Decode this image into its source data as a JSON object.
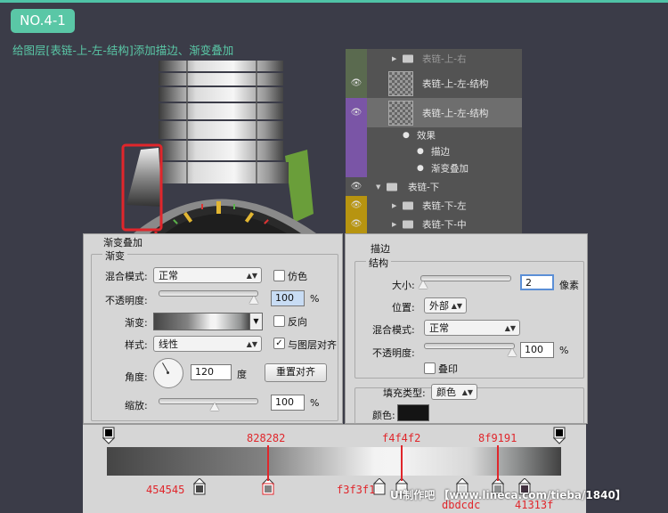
{
  "header": {
    "badge": "NO.4-1",
    "subtitle": "给图层[表链-上-左-结构]添加描边、渐变叠加"
  },
  "colors": {
    "accent": "#5ac7a6",
    "annotation": "#e0262b",
    "strap": "#6a9e3a"
  },
  "layers": [
    {
      "label": "表链-上-右",
      "kind": "folder",
      "color": "#5a6a4f",
      "eye": false
    },
    {
      "label": "表链-上-左-结构",
      "kind": "layer",
      "color": "#5a6a4f",
      "eye": true
    },
    {
      "label": "表链-上-左-结构",
      "kind": "layer",
      "color": "#7a55a6",
      "eye": true,
      "selected": true
    },
    {
      "label": "效果",
      "kind": "fx",
      "color": "#7a55a6",
      "eye": true
    },
    {
      "label": "描边",
      "kind": "fx-item",
      "color": "#7a55a6",
      "eye": true
    },
    {
      "label": "渐变叠加",
      "kind": "fx-item",
      "color": "#7a55a6",
      "eye": true
    },
    {
      "label": "表链-下",
      "kind": "group",
      "color": "#535353",
      "eye": true
    },
    {
      "label": "表链-下-左",
      "kind": "folder",
      "color": "#b79410",
      "eye": true
    },
    {
      "label": "表链-下-中",
      "kind": "folder",
      "color": "#b79410",
      "eye": true
    }
  ],
  "gradient_overlay": {
    "title": "渐变叠加",
    "group": "渐变",
    "blend_mode_label": "混合模式:",
    "blend_mode": "正常",
    "dither_label": "仿色",
    "opacity_label": "不透明度:",
    "opacity": "100",
    "percent": "%",
    "gradient_label": "渐变:",
    "reverse_label": "反向",
    "style_label": "样式:",
    "style": "线性",
    "align_label": "与图层对齐",
    "angle_label": "角度:",
    "angle": "120",
    "degree": "度",
    "reset_label": "重置对齐",
    "scale_label": "缩放:",
    "scale": "100"
  },
  "stroke": {
    "title": "描边",
    "group": "结构",
    "size_label": "大小:",
    "size": "2",
    "unit": "像素",
    "position_label": "位置:",
    "position": "外部",
    "blend_label": "混合模式:",
    "blend": "正常",
    "opacity_label": "不透明度:",
    "opacity": "100",
    "percent": "%",
    "overprint_label": "叠印",
    "fill_type_label": "填充类型:",
    "fill_type": "颜色",
    "color_label": "颜色:",
    "color": "#141414"
  },
  "gradient_stops": {
    "s1": "454545",
    "s2": "828282",
    "s3": "f3f3f1",
    "s4": "f4f4f2",
    "s5": "dbdcdc",
    "s6": "8f9191",
    "s7": "41313f"
  },
  "watermark": "UI制作吧 【www.lineca.com/tieba/1840】"
}
